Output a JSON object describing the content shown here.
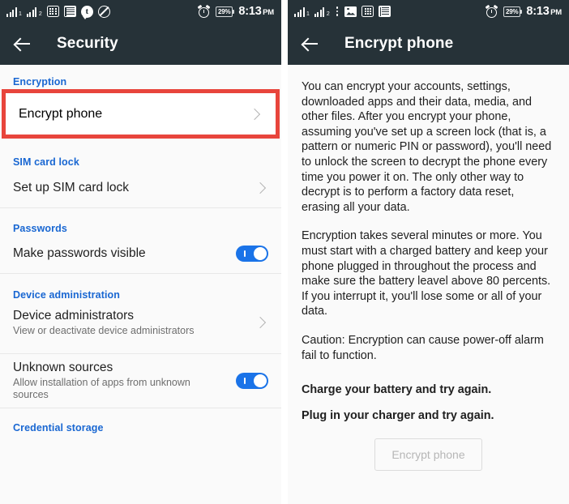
{
  "left_screen": {
    "statusbar": {
      "icons": [
        "signal-bars-sim1-icon",
        "signal-bars-sim2-icon",
        "calculator-icon",
        "news-book-icon",
        "tumblr-chat-icon",
        "do-not-disturb-icon"
      ],
      "alarm_icon": "alarm-clock-icon",
      "battery_percent": "29%",
      "time": "8:13",
      "ampm": "PM"
    },
    "appbar": {
      "back_icon": "back-arrow-icon",
      "title": "Security"
    },
    "sections": [
      {
        "header": "Encryption",
        "items": [
          {
            "title": "Encrypt phone",
            "subtitle": "",
            "control": "chevron",
            "highlighted": true
          }
        ]
      },
      {
        "header": "SIM card lock",
        "items": [
          {
            "title": "Set up SIM card lock",
            "subtitle": "",
            "control": "chevron",
            "highlighted": false
          }
        ]
      },
      {
        "header": "Passwords",
        "items": [
          {
            "title": "Make passwords visible",
            "subtitle": "",
            "control": "toggle-on",
            "highlighted": false
          }
        ]
      },
      {
        "header": "Device administration",
        "items": [
          {
            "title": "Device administrators",
            "subtitle": "View or deactivate device administrators",
            "control": "chevron",
            "highlighted": false
          },
          {
            "title": "Unknown sources",
            "subtitle": "Allow installation of apps from unknown sources",
            "control": "toggle-on",
            "highlighted": false
          }
        ]
      },
      {
        "header": "Credential storage",
        "items": []
      }
    ]
  },
  "right_screen": {
    "statusbar": {
      "icons": [
        "signal-bars-sim1-icon",
        "signal-bars-sim2-icon",
        "overflow-menu-icon",
        "image-icon",
        "calculator-icon",
        "news-book-icon"
      ],
      "alarm_icon": "alarm-clock-icon",
      "battery_percent": "29%",
      "time": "8:13",
      "ampm": "PM"
    },
    "appbar": {
      "back_icon": "back-arrow-icon",
      "title": "Encrypt phone"
    },
    "paragraphs": [
      "You can encrypt your accounts, settings, downloaded apps and their data, media, and other files. After you encrypt your phone, assuming you've set up a screen lock (that is, a pattern or numeric PIN or password), you'll need to unlock the screen to decrypt the phone every time you power it on. The only other way to decrypt is to perform a factory data reset, erasing all your data.",
      "Encryption takes several minutes or more. You must start with a charged battery and keep your phone plugged in throughout the process and make sure the battery leavel above 80 percents. If you interrupt it, you'll lose some or all of your data.",
      "Caution: Encryption can cause power-off alarm fail to function."
    ],
    "warnings": [
      "Charge your battery and try again.",
      "Plug in your charger and try again."
    ],
    "action_button": {
      "label": "Encrypt phone",
      "disabled": true
    }
  },
  "colors": {
    "appbar": "#263238",
    "accent_blue": "#1967d2",
    "toggle_on": "#1a73e8",
    "highlight_red": "#e8453c",
    "page_bg": "#fafafa"
  }
}
